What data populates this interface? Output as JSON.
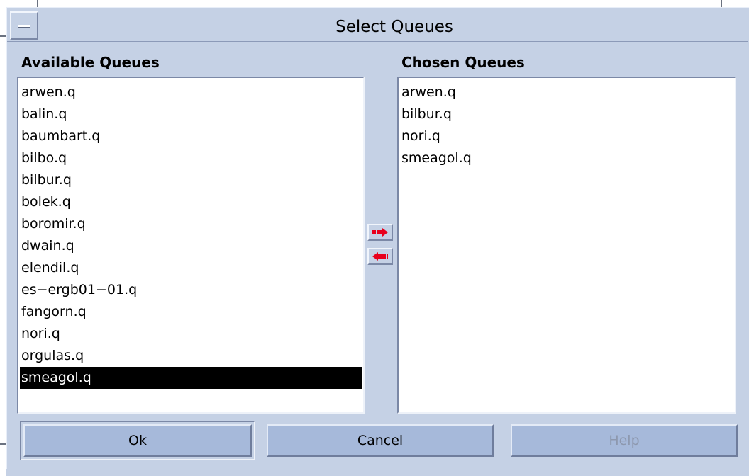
{
  "window": {
    "title": "Select Queues"
  },
  "available": {
    "label": "Available Queues",
    "items": [
      "arwen.q",
      "balin.q",
      "baumbart.q",
      "bilbo.q",
      "bilbur.q",
      "bolek.q",
      "boromir.q",
      "dwain.q",
      "elendil.q",
      "es−ergb01−01.q",
      "fangorn.q",
      "nori.q",
      "orgulas.q",
      "smeagol.q"
    ],
    "selected_index": 13
  },
  "chosen": {
    "label": "Chosen Queues",
    "items": [
      "arwen.q",
      "bilbur.q",
      "nori.q",
      "smeagol.q"
    ]
  },
  "transfer": {
    "add_icon": "right-arrow-icon",
    "remove_icon": "left-arrow-icon",
    "arrow_color": "#e8001c"
  },
  "buttons": {
    "ok": "Ok",
    "cancel": "Cancel",
    "help": "Help"
  },
  "colors": {
    "background": "#c5d1e5",
    "button_face": "#a6b9da",
    "selection": "#000000"
  }
}
